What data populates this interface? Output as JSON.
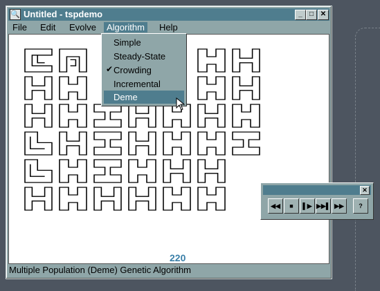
{
  "window": {
    "title": "Untitled - tspdemo",
    "minimize": "_",
    "maximize": "□",
    "close": "✕"
  },
  "menubar": {
    "file": "File",
    "edit": "Edit",
    "evolve": "Evolve",
    "algorithm": "Algorithm",
    "help": "Help"
  },
  "algorithm_menu": {
    "items": [
      {
        "label": "Simple"
      },
      {
        "label": "Steady-State"
      },
      {
        "label": "Crowding",
        "checked": true
      },
      {
        "label": "Incremental"
      },
      {
        "label": "Deme",
        "highlighted": true
      }
    ],
    "check_mark": "✔"
  },
  "generation_count": "220",
  "status_text": "Multiple Population (Deme) Genetic Algorithm",
  "toolbar": {
    "close": "✕",
    "rewind": "◀◀",
    "stop": "■",
    "step": "▌▶",
    "step_fast": "▶▶▌",
    "fast_forward": "▶▶",
    "help": "?"
  },
  "colors": {
    "title_bg": "#4f7d8e",
    "window_face": "#8fa6a8",
    "desktop": "#4d5560",
    "counter": "#3a7fa8"
  }
}
